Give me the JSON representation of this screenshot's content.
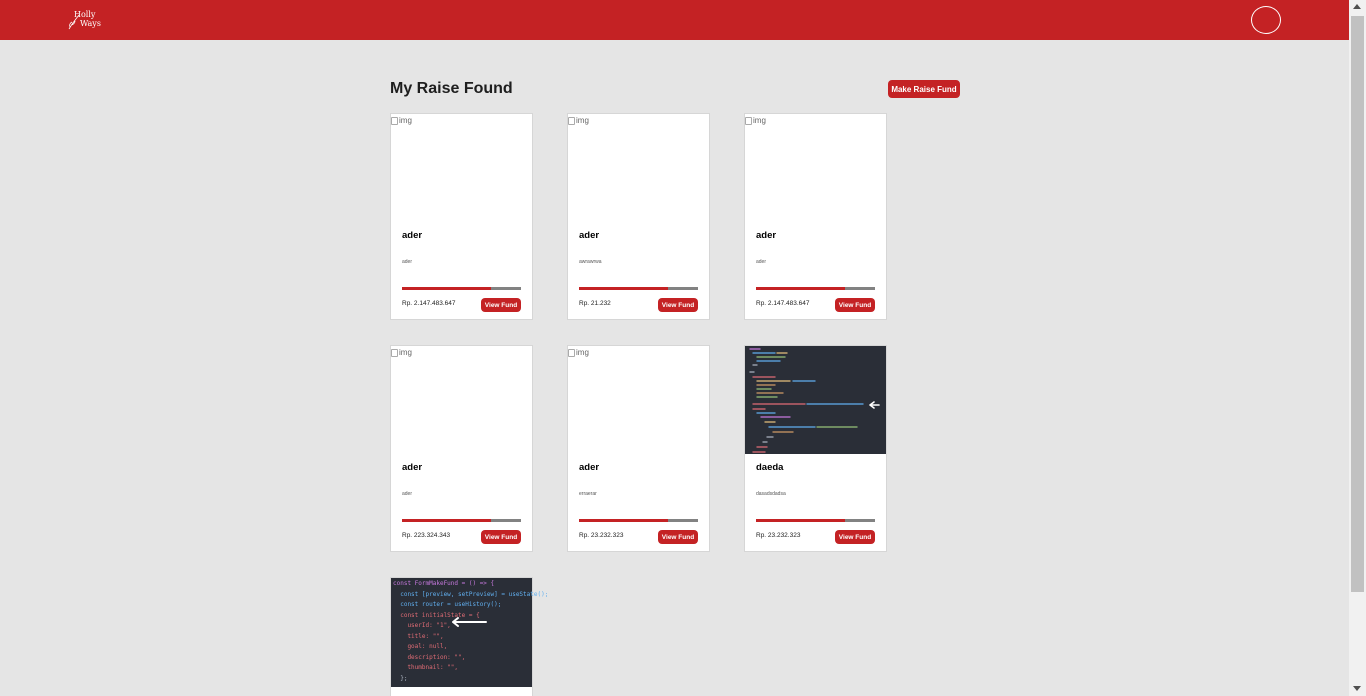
{
  "navbar": {
    "brand_line1": "Holly",
    "brand_line2": "Ways",
    "accent_color": "#c42224"
  },
  "main": {
    "title": "My Raise Found",
    "make_button_label": "Make Raise Fund"
  },
  "cards": [
    {
      "image_alt": "img",
      "image": "broken",
      "title": "ader",
      "description": "ader",
      "progress": 0.75,
      "amount": "Rp. 2.147.483.647",
      "button": "View Fund"
    },
    {
      "image_alt": "img",
      "image": "broken",
      "title": "ader",
      "description": "awrawrwa",
      "progress": 0.75,
      "amount": "Rp. 21.232",
      "button": "View Fund"
    },
    {
      "image_alt": "img",
      "image": "broken",
      "title": "ader",
      "description": "ader",
      "progress": 0.75,
      "amount": "Rp. 2.147.483.647",
      "button": "View Fund"
    },
    {
      "image_alt": "img",
      "image": "broken",
      "title": "ader",
      "description": "ader",
      "progress": 0.75,
      "amount": "Rp. 223.324.343",
      "button": "View Fund"
    },
    {
      "image_alt": "img",
      "image": "broken",
      "title": "ader",
      "description": "erraerar",
      "progress": 0.75,
      "amount": "Rp. 23.232.323",
      "button": "View Fund"
    },
    {
      "image": "code-screenshot",
      "title": "daeda",
      "description": "dasadsdadsa",
      "progress": 0.75,
      "amount": "Rp. 23.232.323",
      "button": "View Fund"
    },
    {
      "image": "code-screenshot",
      "code_lines": [
        "const FormMakeFund = () => {",
        "const [preview, setPreview] = useState();",
        "const router = useHistory();",
        "const initialState = {",
        "userId: \"1\",",
        "title: \"\",",
        "goal: null,",
        "description: \"\",",
        "thumbnail: \"\",",
        "};"
      ]
    }
  ]
}
